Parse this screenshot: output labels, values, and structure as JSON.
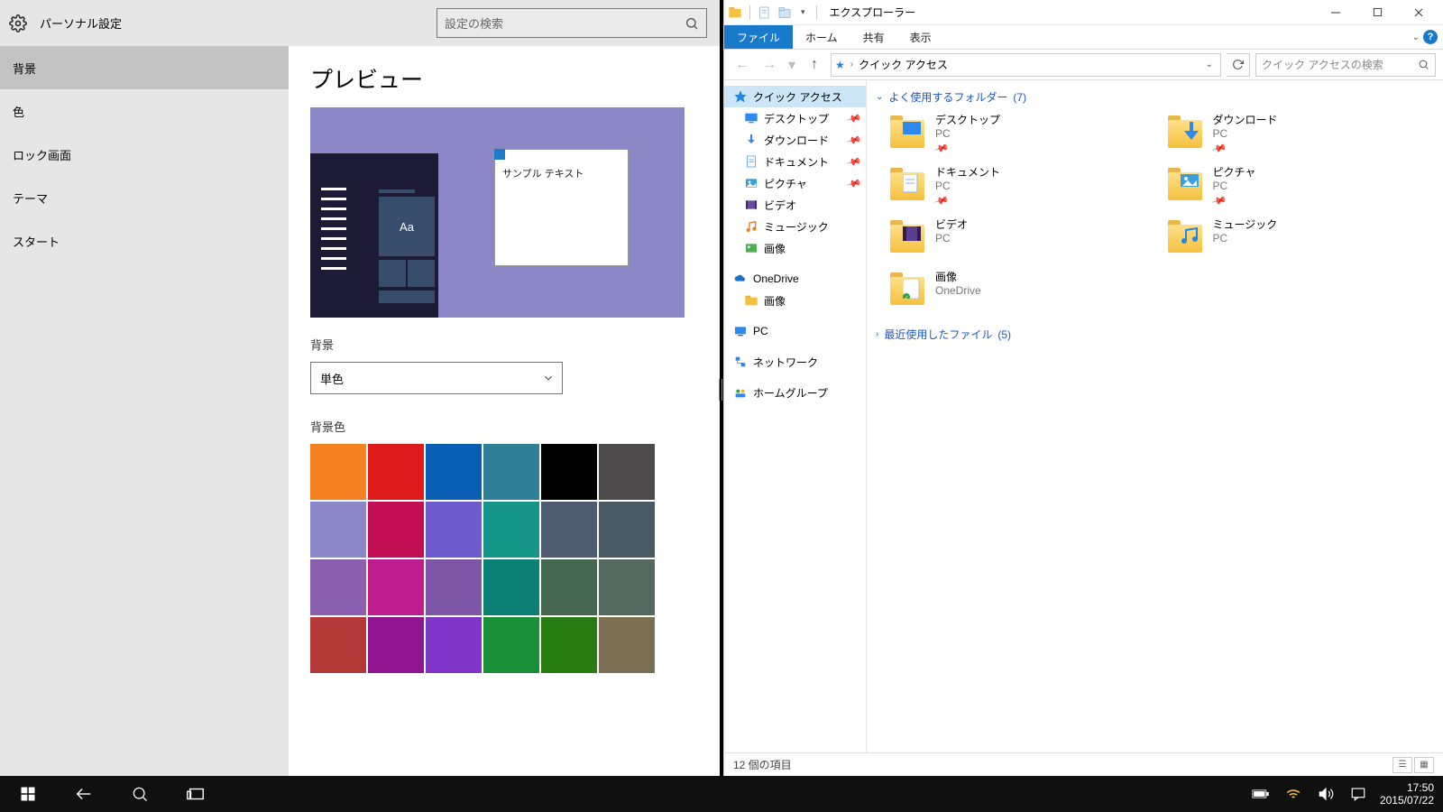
{
  "settings": {
    "title": "パーソナル設定",
    "search_placeholder": "設定の検索",
    "nav": [
      "背景",
      "色",
      "ロック画面",
      "テーマ",
      "スタート"
    ],
    "nav_selected_index": 0,
    "preview_heading": "プレビュー",
    "preview_sample_text": "サンプル テキスト",
    "preview_tile_text": "Aa",
    "bg_label": "背景",
    "bg_option_selected": "単色",
    "bg_color_label": "背景色",
    "swatches": [
      "#f58220",
      "#de1b1b",
      "#0a5fb5",
      "#2f7f98",
      "#000000",
      "#4c4a4a",
      "#8c87c6",
      "#c30d55",
      "#6d5bce",
      "#159688",
      "#4f5b6e",
      "#4a5a62",
      "#8b5fb0",
      "#bf1c8e",
      "#7d57a6",
      "#0c8074",
      "#45664f",
      "#546a60",
      "#b43a3a",
      "#8e1490",
      "#8037c9",
      "#1a8f3a",
      "#277d12",
      "#7a7052"
    ],
    "swatch_selected_index": 6
  },
  "explorer": {
    "window_title": "エクスプローラー",
    "ribbon": {
      "file": "ファイル",
      "home": "ホーム",
      "share": "共有",
      "view": "表示"
    },
    "breadcrumb": [
      "クイック アクセス"
    ],
    "search_placeholder": "クイック アクセスの検索",
    "tree": {
      "quick_access": "クイック アクセス",
      "quick_children": [
        {
          "name": "デスクトップ",
          "icon": "desktop",
          "pinned": true
        },
        {
          "name": "ダウンロード",
          "icon": "download",
          "pinned": true
        },
        {
          "name": "ドキュメント",
          "icon": "document",
          "pinned": true
        },
        {
          "name": "ピクチャ",
          "icon": "picture",
          "pinned": true
        },
        {
          "name": "ビデオ",
          "icon": "video",
          "pinned": false
        },
        {
          "name": "ミュージック",
          "icon": "music",
          "pinned": false
        },
        {
          "name": "画像",
          "icon": "image-green",
          "pinned": false
        }
      ],
      "onedrive": "OneDrive",
      "onedrive_children": [
        {
          "name": "画像",
          "icon": "folder"
        }
      ],
      "pc": "PC",
      "network": "ネットワーク",
      "homegroup": "ホームグループ"
    },
    "groups": {
      "frequent": {
        "label": "よく使用するフォルダー",
        "count": "(7)"
      },
      "recent": {
        "label": "最近使用したファイル",
        "count": "(5)"
      }
    },
    "folders": [
      {
        "name": "デスクトップ",
        "loc": "PC",
        "icon": "desktop"
      },
      {
        "name": "ダウンロード",
        "loc": "PC",
        "icon": "download"
      },
      {
        "name": "ドキュメント",
        "loc": "PC",
        "icon": "document"
      },
      {
        "name": "ピクチャ",
        "loc": "PC",
        "icon": "picture"
      },
      {
        "name": "ビデオ",
        "loc": "PC",
        "icon": "video"
      },
      {
        "name": "ミュージック",
        "loc": "PC",
        "icon": "music"
      },
      {
        "name": "画像",
        "loc": "OneDrive",
        "icon": "onedrive-img"
      }
    ],
    "status": "12 個の項目"
  },
  "taskbar": {
    "time": "17:50",
    "date": "2015/07/22"
  }
}
